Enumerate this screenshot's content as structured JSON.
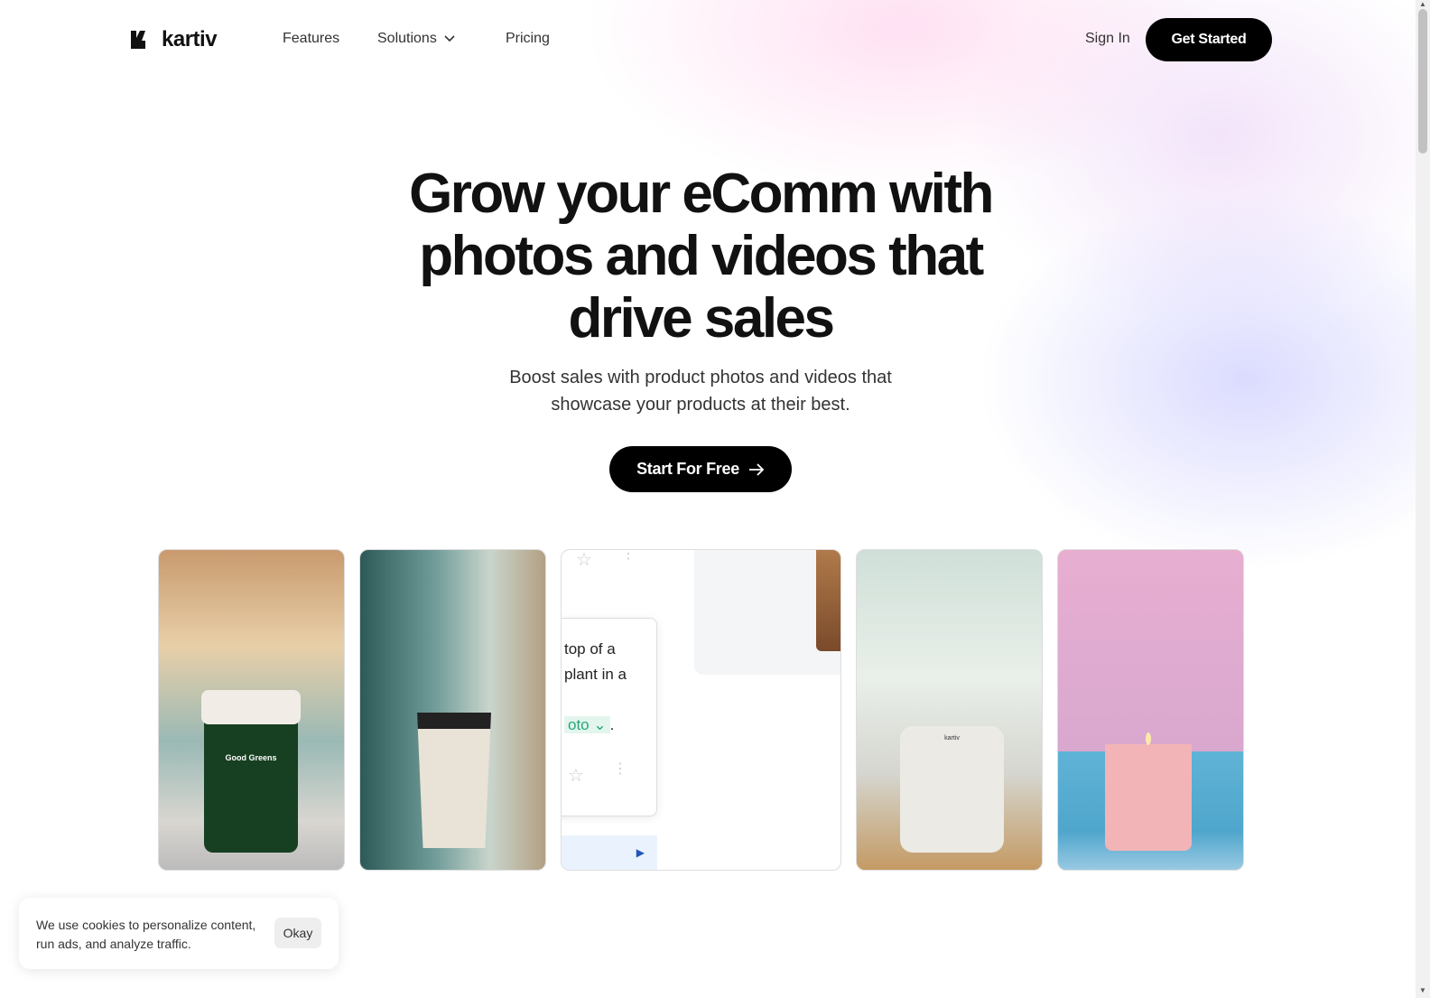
{
  "nav": {
    "brand": "kartiv",
    "links": [
      "Features",
      "Solutions",
      "Pricing"
    ],
    "sign_in": "Sign In",
    "get_started": "Get Started"
  },
  "hero": {
    "title": "Grow your eComm with photos and videos that drive sales",
    "subtitle_line1": "Boost sales with product photos and videos that",
    "subtitle_line2": "showcase your products at their best.",
    "cta": "Start For Free"
  },
  "gallery": {
    "jar_label": "Good Greens",
    "device_label": "kartiv",
    "prompt_line1": "top of a",
    "prompt_line2": "plant in a",
    "prompt_chip": "oto",
    "prompt_end": "."
  },
  "cookie": {
    "text": "We use cookies to personalize content, run ads, and analyze traffic.",
    "button": "Okay"
  }
}
